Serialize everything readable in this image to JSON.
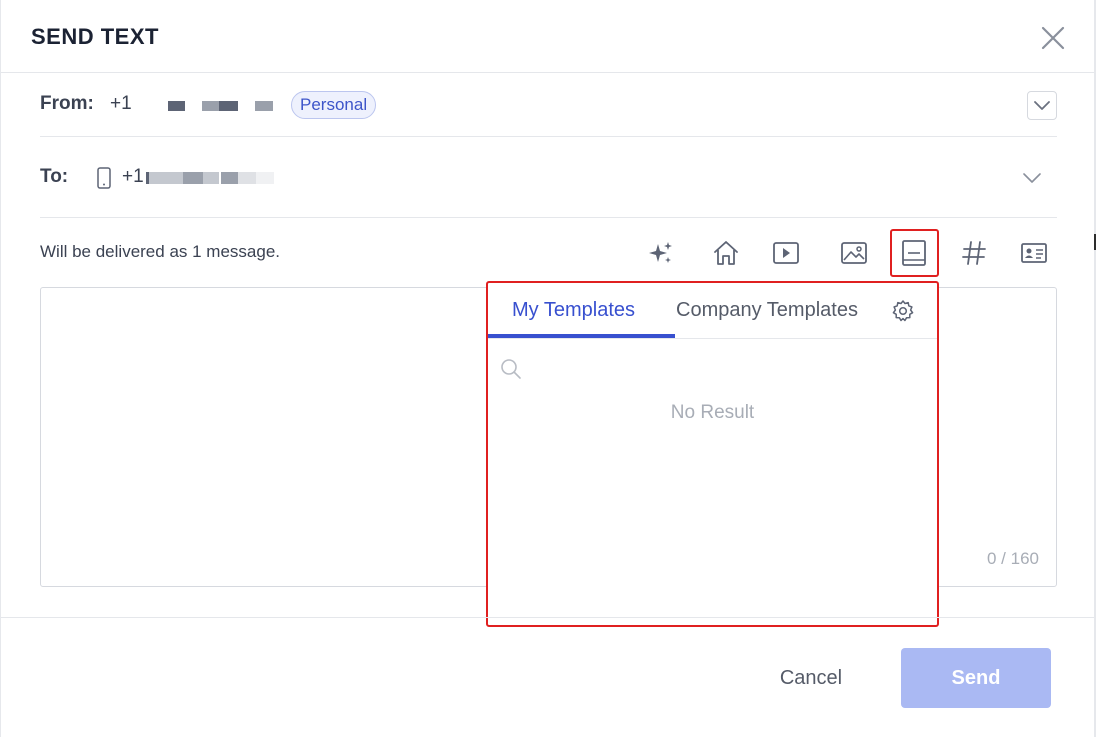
{
  "dialog": {
    "title": "SEND TEXT"
  },
  "from": {
    "label": "From:",
    "number_prefix": "+1",
    "badge": "Personal"
  },
  "to": {
    "label": "To:",
    "number_prefix": "+1"
  },
  "compose": {
    "delivery_note": "Will be delivered as 1 message.",
    "char_counter": "0 / 160"
  },
  "toolbar": {
    "icons": [
      "ai-sparkle-icon",
      "home-icon",
      "video-icon",
      "image-icon",
      "template-icon",
      "hashtag-icon",
      "contact-card-icon"
    ],
    "active_icon": "template-icon"
  },
  "templates_popup": {
    "tabs": [
      "My Templates",
      "Company Templates"
    ],
    "active_tab": "My Templates",
    "search_placeholder": "",
    "empty_text": "No Result"
  },
  "footer": {
    "cancel_label": "Cancel",
    "send_label": "Send"
  },
  "colors": {
    "accent": "#3850cf",
    "send_disabled": "#aab9f3",
    "highlight": "#e02020",
    "badge_bg": "#eef1fd"
  }
}
